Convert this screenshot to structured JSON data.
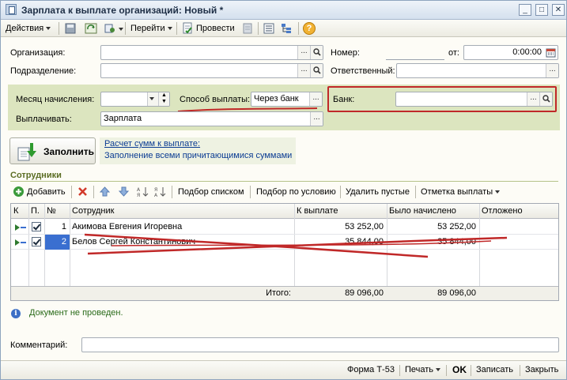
{
  "window": {
    "title": "Зарплата к выплате организаций: Новый *",
    "minimize_glyph": "_",
    "maximize_glyph": "□",
    "close_glyph": "✕"
  },
  "toolbar": {
    "actions_label": "Действия",
    "goto_label": "Перейти",
    "post_label": "Провести",
    "help_glyph": "?"
  },
  "form": {
    "organization_label": "Организация:",
    "organization_value": "",
    "department_label": "Подразделение:",
    "department_value": "",
    "number_label": "Номер:",
    "number_value": "",
    "date_label": "от:",
    "date_value": "0:00:00",
    "responsible_label": "Ответственный:",
    "responsible_value": "",
    "month_label": "Месяц начисления:",
    "month_value": "",
    "payment_method_label": "Способ выплаты:",
    "payment_method_value": "Через банк",
    "bank_label": "Банк:",
    "bank_value": "",
    "pay_label": "Выплачивать:",
    "pay_value": "Зарплата",
    "ellipsis": "...",
    "search_glyph": "🔍"
  },
  "fill": {
    "button_label": "Заполнить",
    "calc_link": "Расчет сумм к выплате:",
    "calc_desc": "Заполнение всеми причитающимися суммами"
  },
  "employees": {
    "section_title": "Сотрудники",
    "toolbar": {
      "add_label": "Добавить",
      "select_list_label": "Подбор списком",
      "select_condition_label": "Подбор по условию",
      "delete_empty_label": "Удалить пустые",
      "payment_mark_label": "Отметка выплаты"
    },
    "columns": {
      "k": "К",
      "p": "П.",
      "n": "№",
      "employee": "Сотрудник",
      "to_pay": "К выплате",
      "accrued": "Было начислено",
      "deferred": "Отложено"
    },
    "rows": [
      {
        "n": "1",
        "employee": "Акимова Евгения Игоревна",
        "to_pay": "53 252,00",
        "accrued": "53 252,00",
        "deferred": ""
      },
      {
        "n": "2",
        "employee": "Белов Сергей Константинович",
        "to_pay": "35 844,00",
        "accrued": "35 844,00",
        "deferred": ""
      }
    ],
    "total_label": "Итого:",
    "total_to_pay": "89 096,00",
    "total_accrued": "89 096,00"
  },
  "status": {
    "info_glyph": "i",
    "text": "Документ не проведен."
  },
  "comment": {
    "label": "Комментарий:",
    "value": ""
  },
  "footer": {
    "form_label": "Форма Т-53",
    "print_label": "Печать",
    "ok_label": "OK",
    "save_label": "Записать",
    "close_label": "Закрыть"
  },
  "colors": {
    "panel_green": "#dce5bf",
    "highlight_red": "#c02828",
    "selection_blue": "#3a6fd0"
  }
}
